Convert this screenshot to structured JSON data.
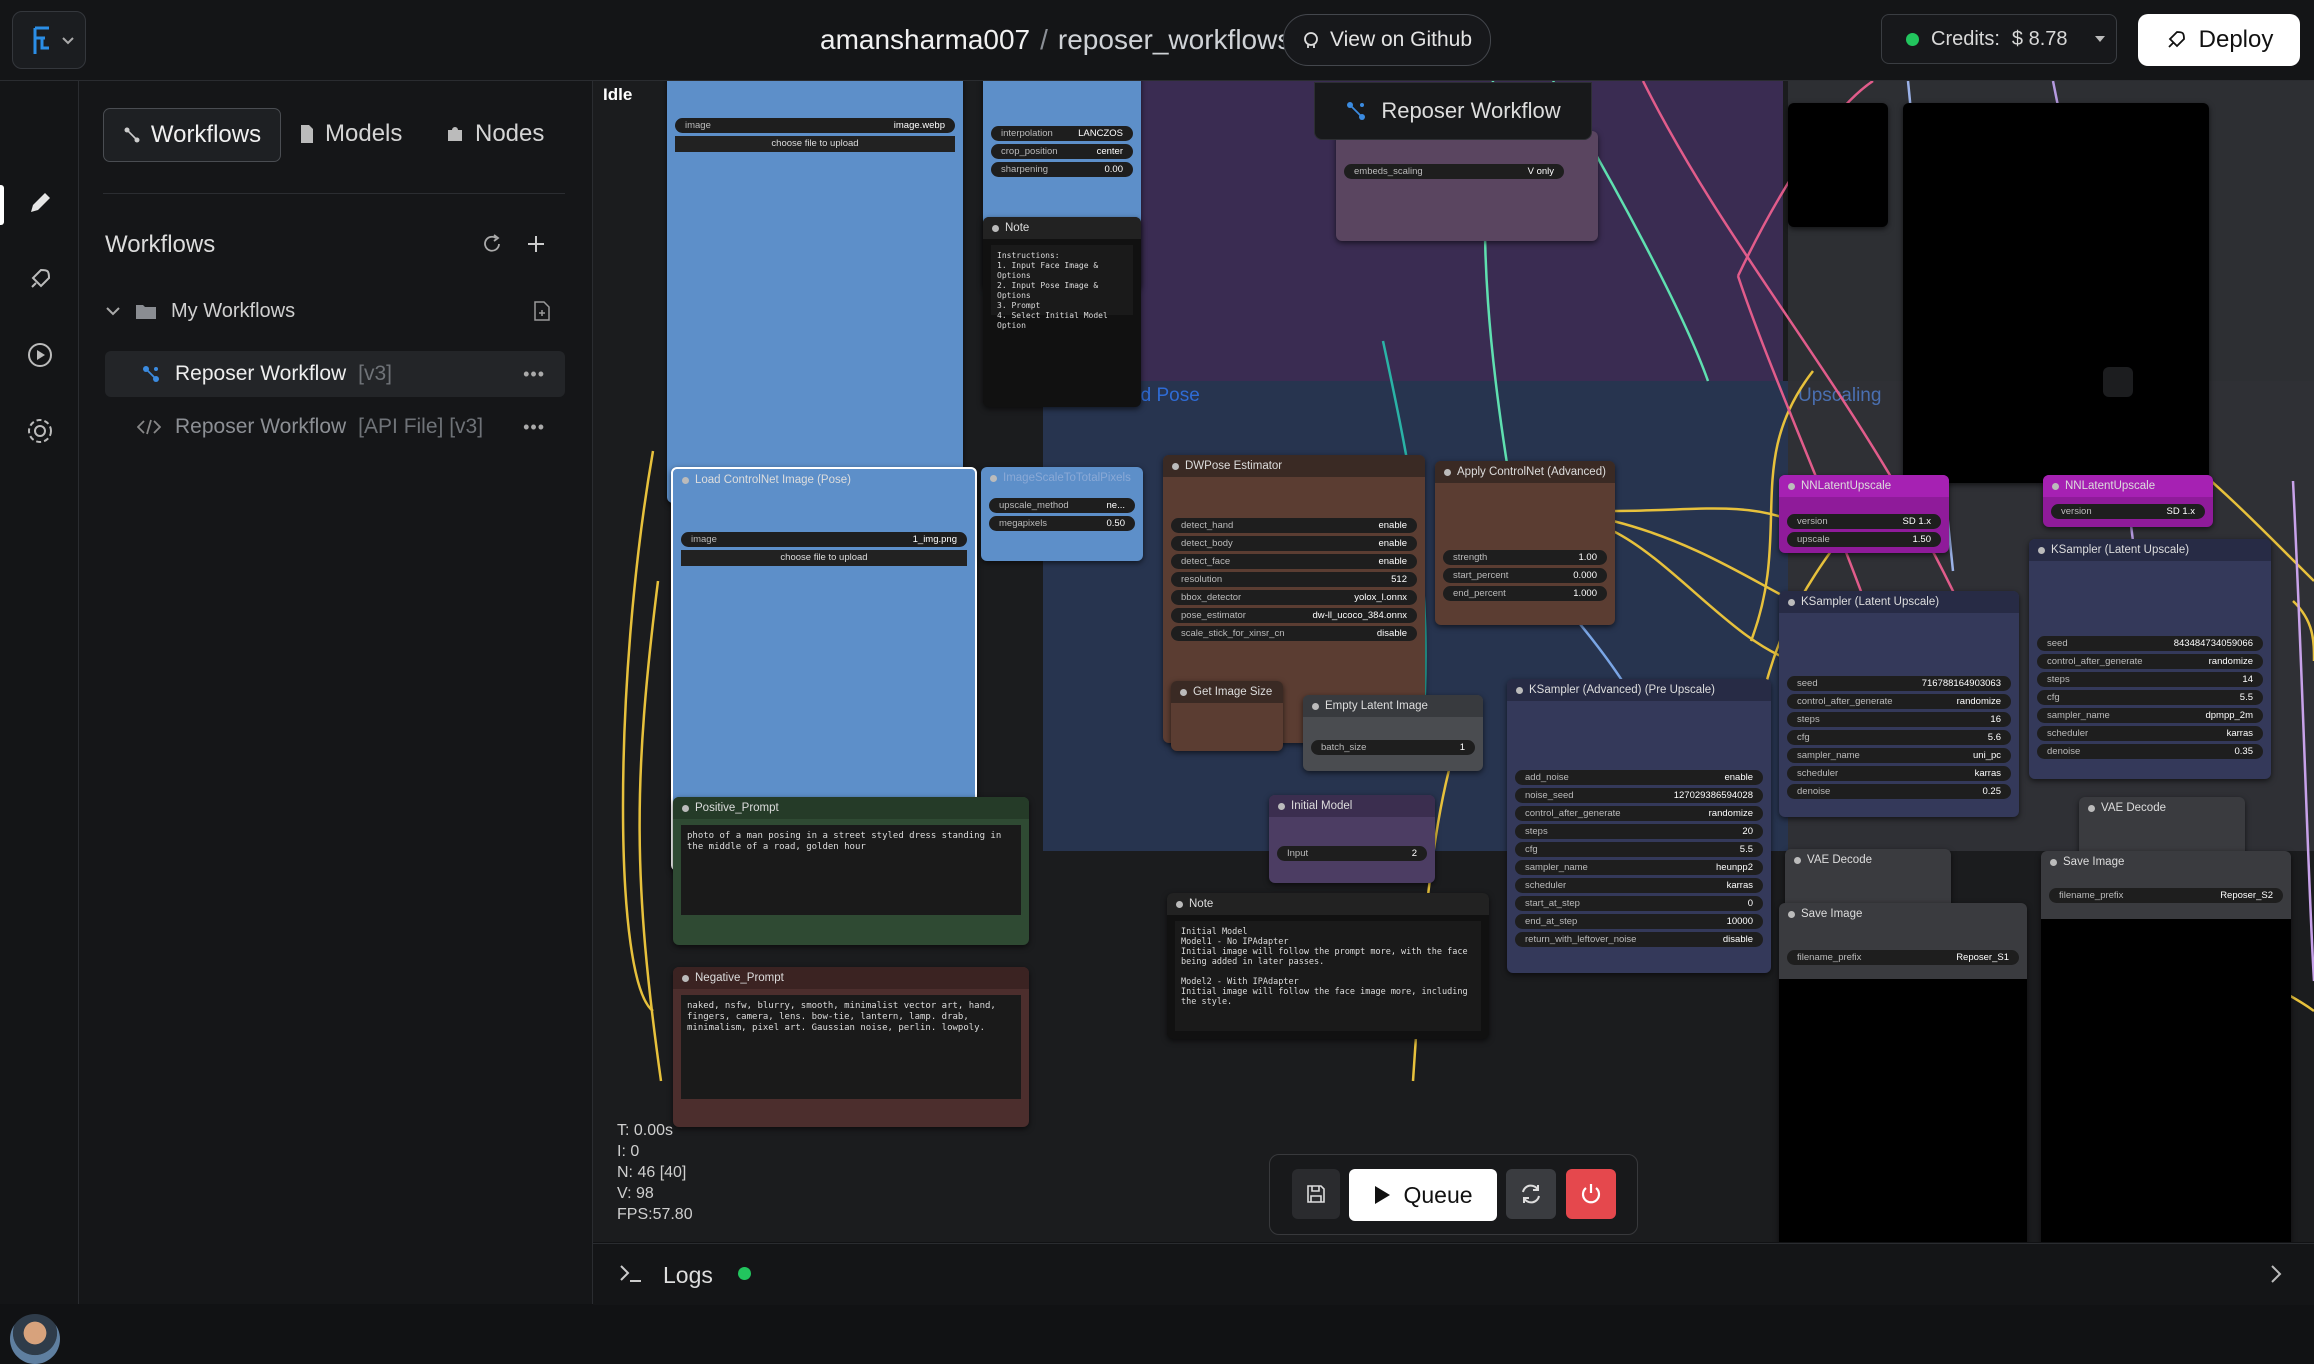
{
  "header": {
    "username": "amansharma007",
    "separator": "/",
    "repo": "reposer_workflows",
    "github_label": "View on Github",
    "credits_label": "Credits:",
    "credits_value": "$ 8.78",
    "deploy_label": "Deploy"
  },
  "rail": {
    "items": [
      "pencil-icon",
      "rocket-icon",
      "play-circle-icon",
      "gear-icon"
    ]
  },
  "sidebar": {
    "tabs": [
      {
        "label": "Workflows",
        "icon": "workflow-icon"
      },
      {
        "label": "Models",
        "icon": "file-icon"
      },
      {
        "label": "Nodes",
        "icon": "puzzle-icon"
      }
    ],
    "heading": "Workflows",
    "folder": "My Workflows",
    "items": [
      {
        "label": "Reposer Workflow",
        "version": "[v3]"
      },
      {
        "label": "Reposer Workflow",
        "version": "[API File] [v3]"
      }
    ]
  },
  "canvas": {
    "status": "Idle",
    "floating_title": "Reposer Workflow",
    "groups": {
      "prompt_pose": "Prompt and Pose",
      "upscaling": "Upscaling"
    },
    "stats": {
      "t": "T: 0.00s",
      "i": "I: 0",
      "n": "N: 46 [40]",
      "v": "V: 98",
      "fps": "FPS:57.80"
    },
    "nodes": {
      "load_image_top": {
        "w_image": "image",
        "v_image": "image.webp",
        "upload": "choose file to upload"
      },
      "resize_top": {
        "rows": [
          [
            "interpolation",
            "LANCZOS"
          ],
          [
            "crop_position",
            "center"
          ],
          [
            "sharpening",
            "0.00"
          ]
        ]
      },
      "note_top": {
        "title": "Note",
        "text": "Instructions:\n1. Input Face Image & Options\n2. Input Pose Image & Options\n3. Prompt\n4. Select Initial Model Option"
      },
      "load_pose": {
        "title": "Load ControlNet Image (Pose)",
        "w_image": "image",
        "v_image": "1_img.png",
        "upload": "choose file to upload"
      },
      "scale_pixels": {
        "title": "ImageScaleToTotalPixels",
        "rows": [
          [
            "upscale_method",
            "ne..."
          ],
          [
            "megapixels",
            "0.50"
          ]
        ]
      },
      "dwpose": {
        "title": "DWPose Estimator",
        "rows": [
          [
            "detect_hand",
            "enable"
          ],
          [
            "detect_body",
            "enable"
          ],
          [
            "detect_face",
            "enable"
          ],
          [
            "resolution",
            "512"
          ],
          [
            "bbox_detector",
            "yolox_l.onnx"
          ],
          [
            "pose_estimator",
            "dw-ll_ucoco_384.onnx"
          ],
          [
            "scale_stick_for_xinsr_cn",
            "disable"
          ]
        ]
      },
      "apply_cn": {
        "title": "Apply ControlNet (Advanced)",
        "rows": [
          [
            "strength",
            "1.00"
          ],
          [
            "start_percent",
            "0.000"
          ],
          [
            "end_percent",
            "1.000"
          ]
        ]
      },
      "get_size": {
        "title": "Get Image Size"
      },
      "empty_latent": {
        "title": "Empty Latent Image",
        "rows": [
          [
            "batch_size",
            "1"
          ]
        ]
      },
      "initial_model": {
        "title": "Initial Model",
        "rows": [
          [
            "Input",
            "2"
          ]
        ]
      },
      "positive": {
        "title": "Positive_Prompt",
        "text": "photo of a man posing in a street styled dress standing in the middle of a road, golden hour"
      },
      "negative": {
        "title": "Negative_Prompt",
        "text": "naked, nsfw, blurry, smooth, minimalist vector art, hand, fingers, camera, lens. bow-tie, lantern, lamp. drab, minimalism, pixel art. Gaussian noise, perlin. lowpoly."
      },
      "note_model": {
        "title": "Note",
        "text": "Initial Model\nModel1 - No IPAdapter\nInitial image will follow the prompt more, with the face being added in later passes.\n\nModel2 - With IPAdapter\nInitial image will follow the face image more, including the style."
      },
      "ksampler_adv": {
        "title": "KSampler (Advanced) (Pre Upscale)",
        "rows": [
          [
            "add_noise",
            "enable"
          ],
          [
            "noise_seed",
            "127029386594028"
          ],
          [
            "control_after_generate",
            "randomize"
          ],
          [
            "steps",
            "20"
          ],
          [
            "cfg",
            "5.5"
          ],
          [
            "sampler_name",
            "heunpp2"
          ],
          [
            "scheduler",
            "karras"
          ],
          [
            "start_at_step",
            "0"
          ],
          [
            "end_at_step",
            "10000"
          ],
          [
            "return_with_leftover_noise",
            "disable"
          ]
        ]
      },
      "nn_upscale_1": {
        "title": "NNLatentUpscale",
        "rows": [
          [
            "version",
            "SD 1.x"
          ],
          [
            "upscale",
            "1.50"
          ]
        ]
      },
      "nn_upscale_2": {
        "title": "NNLatentUpscale",
        "rows": [
          [
            "version",
            "SD 1.x"
          ]
        ]
      },
      "ks_upscale_1": {
        "title": "KSampler (Latent Upscale)",
        "rows": [
          [
            "seed",
            "716788164903063"
          ],
          [
            "control_after_generate",
            "randomize"
          ],
          [
            "steps",
            "16"
          ],
          [
            "cfg",
            "5.6"
          ],
          [
            "sampler_name",
            "uni_pc"
          ],
          [
            "scheduler",
            "karras"
          ],
          [
            "denoise",
            "0.25"
          ]
        ]
      },
      "ks_upscale_2": {
        "title": "KSampler (Latent Upscale)",
        "rows": [
          [
            "seed",
            "843484734059066"
          ],
          [
            "control_after_generate",
            "randomize"
          ],
          [
            "steps",
            "14"
          ],
          [
            "cfg",
            "5.5"
          ],
          [
            "sampler_name",
            "dpmpp_2m"
          ],
          [
            "scheduler",
            "karras"
          ],
          [
            "denoise",
            "0.35"
          ]
        ]
      },
      "vae_1": {
        "title": "VAE Decode"
      },
      "vae_2": {
        "title": "VAE Decode"
      },
      "save_1": {
        "title": "Save Image",
        "rows": [
          [
            "filename_prefix",
            "Reposer_S1"
          ]
        ]
      },
      "save_2": {
        "title": "Save Image",
        "rows": [
          [
            "filename_prefix",
            "Reposer_S2"
          ]
        ]
      },
      "misc_top": {
        "rows": [
          [
            "embeds_scaling",
            "V only"
          ]
        ]
      }
    }
  },
  "toolbar": {
    "queue_label": "Queue"
  },
  "logs": {
    "label": "Logs"
  },
  "colors": {
    "accent_green": "#22c55e",
    "stop_red": "#e5484d",
    "group_blue": "#3572d8"
  }
}
